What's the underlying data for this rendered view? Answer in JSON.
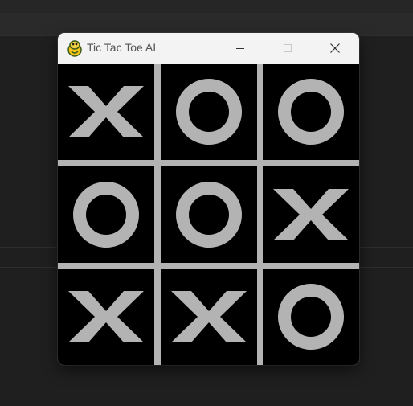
{
  "window": {
    "title": "Tic Tac Toe AI",
    "app_icon": "python-snake-icon"
  },
  "board": {
    "cells": [
      [
        "X",
        "O",
        "O"
      ],
      [
        "O",
        "O",
        "X"
      ],
      [
        "X",
        "X",
        "O"
      ]
    ],
    "mark_color": "#b3b3b3",
    "background_color": "#000000",
    "grid_color": "#b3b3b3"
  }
}
